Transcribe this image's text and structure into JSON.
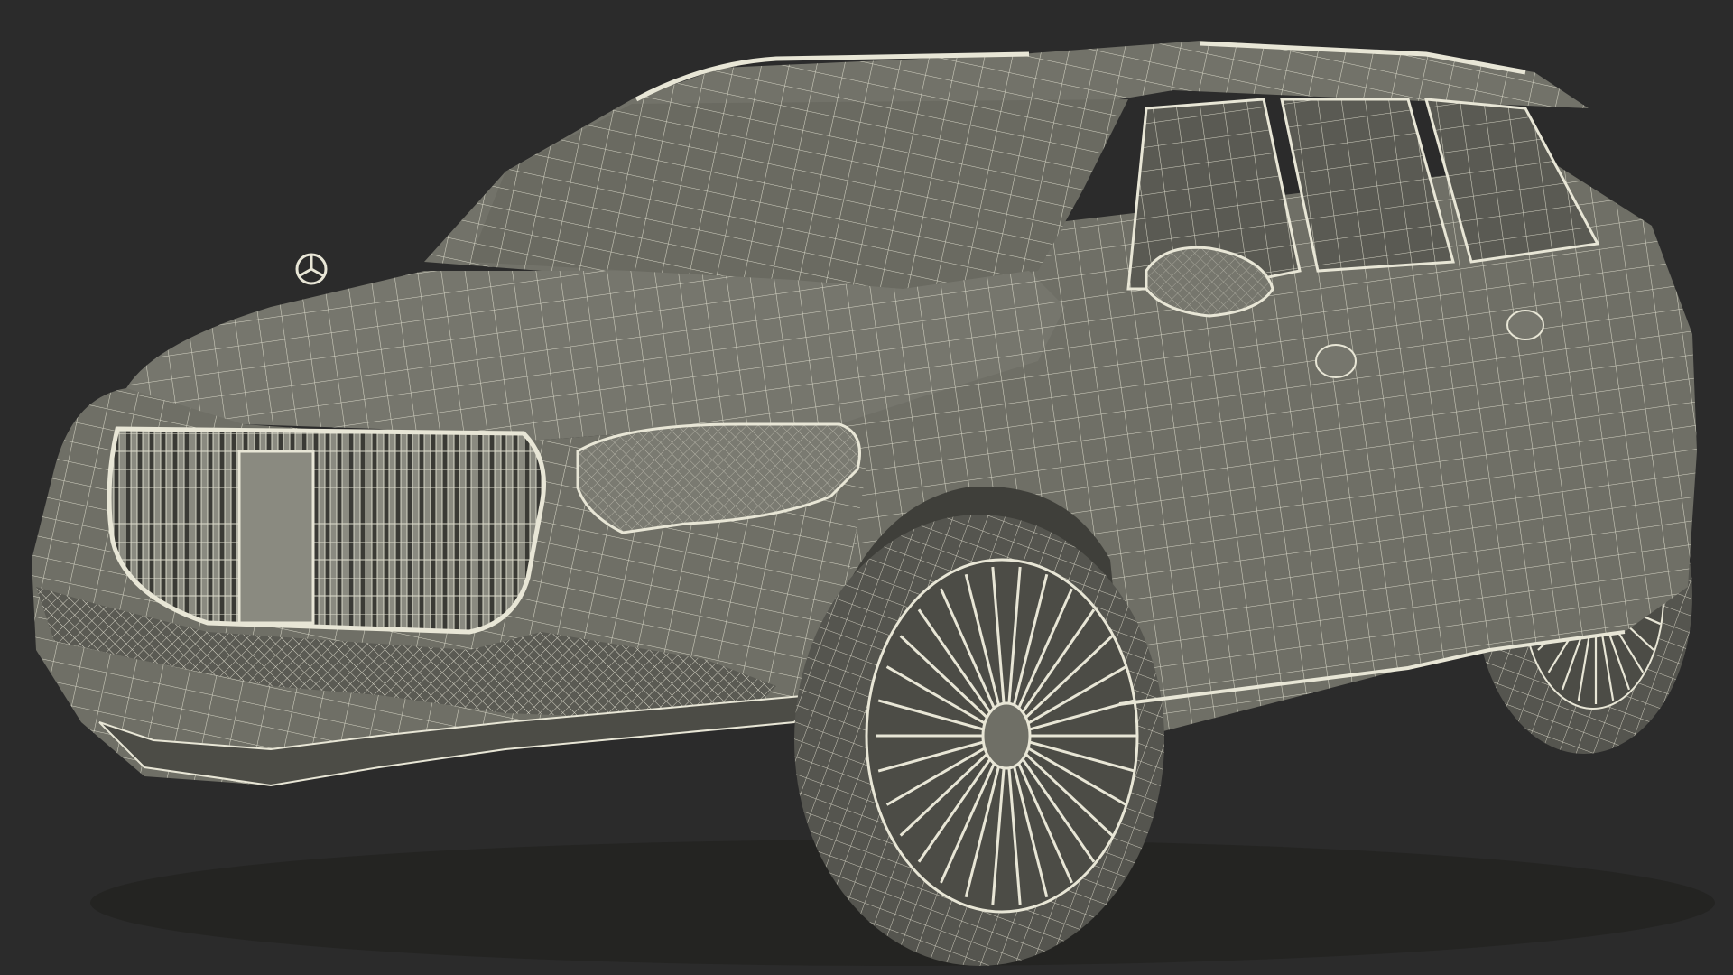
{
  "scene": {
    "subject": "suv-wireframe-render",
    "colors": {
      "background": "#2b2b2b",
      "body": "#6f6f66",
      "body_shadow": "#4c4c46",
      "glass": "#5a5a53",
      "wire": "#e8e6d6",
      "tire": "#55554f",
      "grille_dark": "#3a3a35"
    },
    "icons": [
      "three-pointed-star-emblem-icon"
    ]
  }
}
